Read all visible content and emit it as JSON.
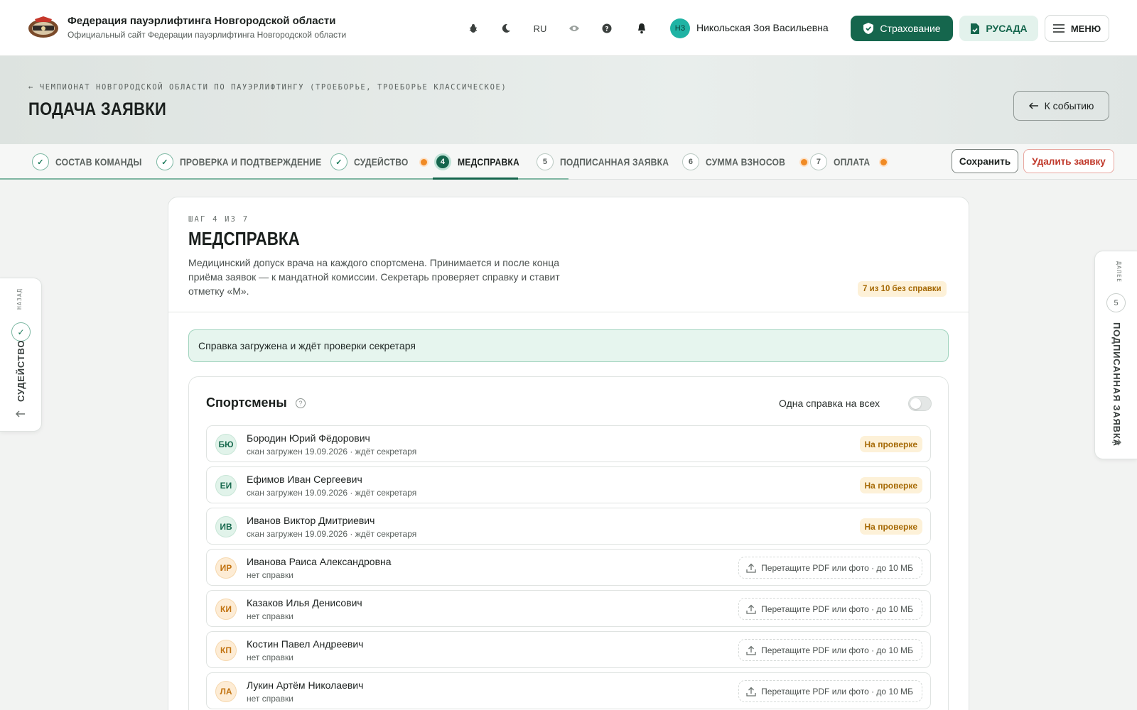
{
  "header": {
    "title": "Федерация пауэрлифтинга Новгородской области",
    "subtitle": "Официальный сайт Федерации пауэрлифтинга Новгородской области",
    "lang": "RU",
    "user_initials": "НЗ",
    "user_name": "Никольская Зоя Васильевна",
    "insurance_label": "Страхование",
    "rusada_label": "РУСАДА",
    "menu_label": "МЕНЮ"
  },
  "hero": {
    "breadcrumb": "ЧЕМПИОНАТ НОВГОРОДСКОЙ ОБЛАСТИ ПО ПАУЭРЛИФТИНГУ (ТРОЕБОРЬЕ, ТРОЕБОРЬЕ КЛАССИЧЕСКОЕ)",
    "title": "ПОДАЧА ЗАЯВКИ",
    "back_to_event": "К событию"
  },
  "steps": [
    {
      "num": "1",
      "label": "СОСТАВ КОМАНДЫ",
      "state": "done",
      "dot": false
    },
    {
      "num": "2",
      "label": "ПРОВЕРКА И ПОДТВЕРЖДЕНИЕ",
      "state": "done",
      "dot": false
    },
    {
      "num": "3",
      "label": "СУДЕЙСТВО",
      "state": "done",
      "dot": true
    },
    {
      "num": "4",
      "label": "МЕДСПРАВКА",
      "state": "active",
      "dot": false
    },
    {
      "num": "5",
      "label": "ПОДПИСАННАЯ ЗАЯВКА",
      "state": "todo",
      "dot": false
    },
    {
      "num": "6",
      "label": "СУММА ВЗНОСОВ",
      "state": "todo",
      "dot": true
    },
    {
      "num": "7",
      "label": "ОПЛАТА",
      "state": "todo",
      "dot": true
    }
  ],
  "actions": {
    "save": "Сохранить",
    "delete": "Удалить заявку"
  },
  "card": {
    "step_of": "ШАГ 4 ИЗ 7",
    "title": "МЕДСПРАВКА",
    "description": "Медицинский допуск врача на каждого спортсмена. Принимается и после конца приёма заявок — к мандатной комиссии. Секретарь проверяет справку и ставит отметку «М».",
    "missing_badge": "7 из 10 без справки",
    "alert": "Справка загружена и ждёт проверки секретаря"
  },
  "athletes": {
    "title": "Спортсмены",
    "one_for_all": "Одна справка на всех",
    "upload_hint": "Перетащите PDF или фото · до 10 МБ",
    "rows": [
      {
        "initials": "БЮ",
        "name": "Бородин Юрий Фёдорович",
        "status": "скан загружен 19.09.2026 · ждёт секретаря",
        "badge": "На проверке",
        "has_cert": true
      },
      {
        "initials": "ЕИ",
        "name": "Ефимов Иван Сергеевич",
        "status": "скан загружен 19.09.2026 · ждёт секретаря",
        "badge": "На проверке",
        "has_cert": true
      },
      {
        "initials": "ИВ",
        "name": "Иванов Виктор Дмитриевич",
        "status": "скан загружен 19.09.2026 · ждёт секретаря",
        "badge": "На проверке",
        "has_cert": true
      },
      {
        "initials": "ИР",
        "name": "Иванова Раиса Александровна",
        "status": "нет справки",
        "badge": "",
        "has_cert": false
      },
      {
        "initials": "КИ",
        "name": "Казаков Илья Денисович",
        "status": "нет справки",
        "badge": "",
        "has_cert": false
      },
      {
        "initials": "КП",
        "name": "Костин Павел Андреевич",
        "status": "нет справки",
        "badge": "",
        "has_cert": false
      },
      {
        "initials": "ЛА",
        "name": "Лукин Артём Николаевич",
        "status": "нет справки",
        "badge": "",
        "has_cert": false
      }
    ]
  },
  "side_nav": {
    "back_caption": "НАЗАД",
    "back_label": "СУДЕЙСТВО",
    "next_caption": "ДАЛЕЕ",
    "next_num": "5",
    "next_label": "ПОДПИСАННАЯ ЗАЯВКА"
  },
  "colors": {
    "brand": "#15664d",
    "warning": "#f08a24",
    "danger": "#c0392b"
  }
}
